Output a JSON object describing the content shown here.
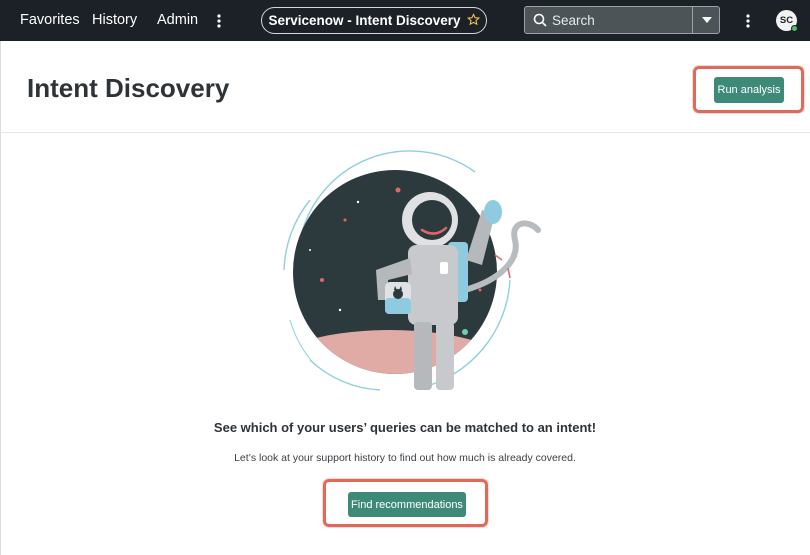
{
  "nav": {
    "favorites": "Favorites",
    "history": "History",
    "admin": "Admin",
    "app_title": "Servicenow - Intent Discovery",
    "search_placeholder": "Search",
    "avatar_initials": "SC"
  },
  "page": {
    "title": "Intent Discovery",
    "run_analysis_label": "Run analysis",
    "headline": "See which of your users’ queries can be matched to an intent!",
    "subline": "Let’s look at your support history to find out how much is already covered.",
    "find_recommendations_label": "Find recommendations"
  },
  "colors": {
    "nav_bg": "#1b2126",
    "primary_button": "#3e8a79",
    "highlight": "#e06a5a"
  }
}
